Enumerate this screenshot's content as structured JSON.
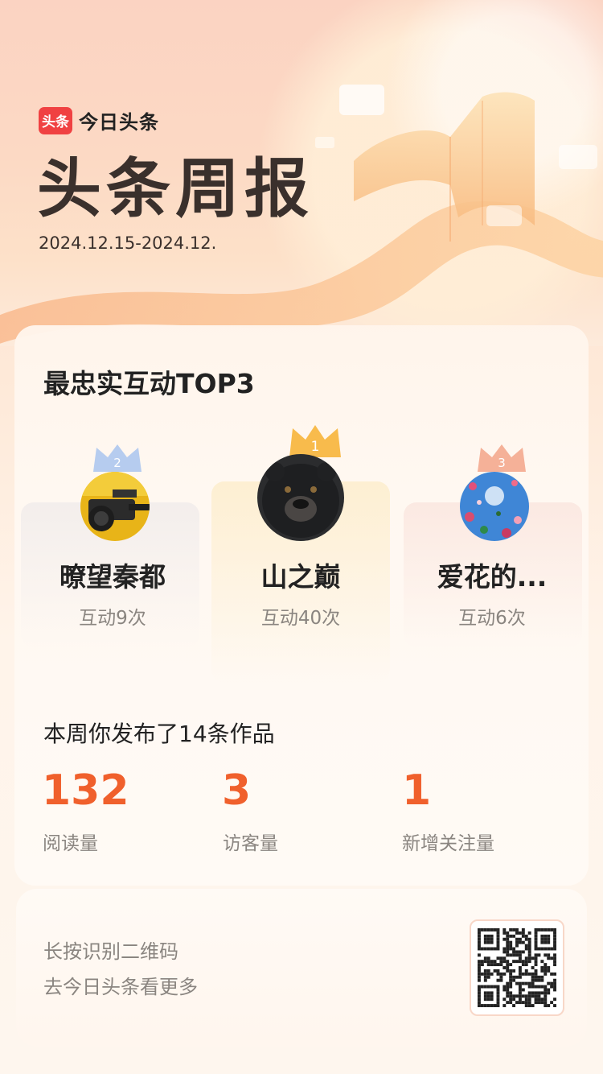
{
  "header": {
    "logo_badge": "头条",
    "app_name": "今日头条",
    "title": "头条周报",
    "date_range": "2024.12.15-2024.12."
  },
  "colors": {
    "accent": "#f0602c",
    "brand_red": "#f04142",
    "crown_gold": "#f7b43a",
    "crown_silver": "#a9c4ee",
    "crown_bronze": "#f3a488"
  },
  "fans_section": {
    "title": "最忠实互动TOP3",
    "fans": [
      {
        "rank": "2",
        "name": "暸望秦都",
        "count": "互动9次",
        "avatar": "camera-rig-avatar"
      },
      {
        "rank": "1",
        "name": "山之巅",
        "count": "互动40次",
        "avatar": "black-bear-avatar"
      },
      {
        "rank": "3",
        "name": "爱花的...",
        "count": "互动6次",
        "avatar": "flowers-sky-avatar"
      }
    ]
  },
  "stats": {
    "summary": "本周你发布了14条作品",
    "items": [
      {
        "value": "132",
        "label": "阅读量"
      },
      {
        "value": "3",
        "label": "访客量"
      },
      {
        "value": "1",
        "label": "新增关注量"
      }
    ]
  },
  "footer": {
    "line1": "长按识别二维码",
    "line2": "去今日头条看更多",
    "qr_icon": "qr-code-icon"
  }
}
